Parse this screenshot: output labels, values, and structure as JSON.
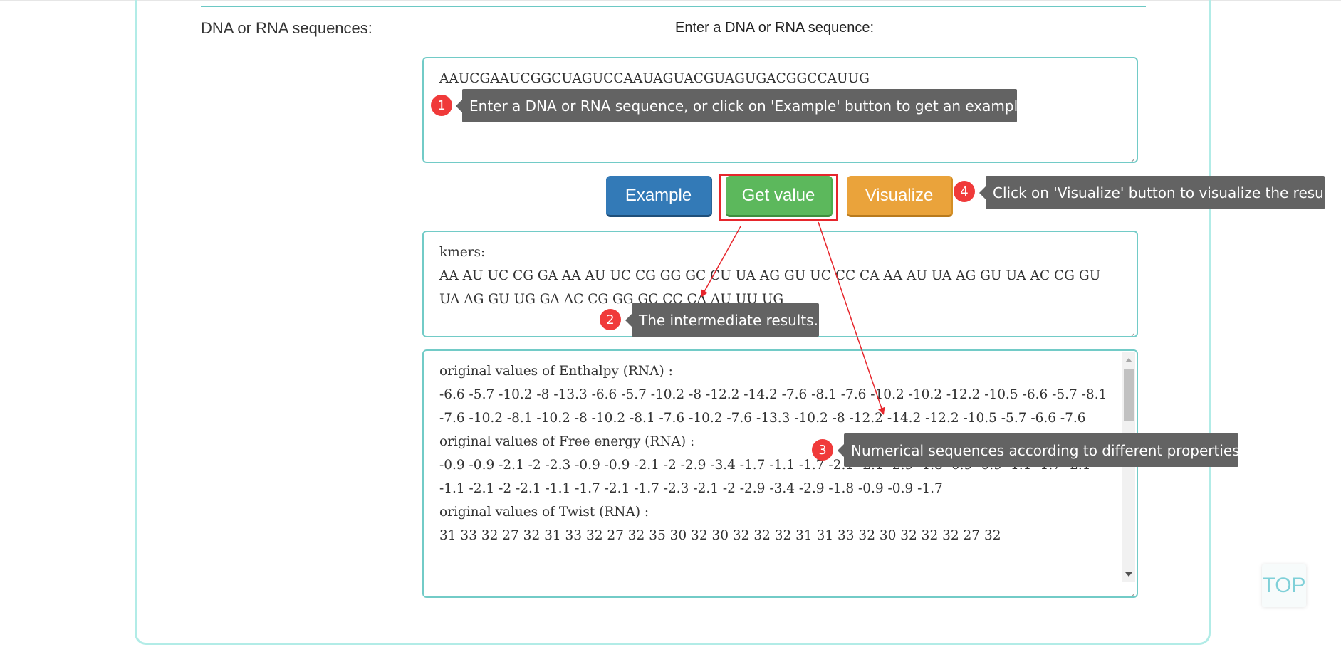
{
  "section": {
    "label": "DNA or RNA sequences:",
    "input_heading": "Enter a DNA or RNA sequence:"
  },
  "sequence_input": {
    "value": "AAUCGAAUCGGCUAGUCCAAUAGUACGUAGUGACGGCCAUUG"
  },
  "buttons": {
    "example": "Example",
    "get_value": "Get value",
    "visualize": "Visualize"
  },
  "kmers_output": {
    "value": "kmers:\nAA AU UC CG GA AA AU UC CG GG GC CU UA AG GU UC CC CA AA AU UA AG GU UA AC CG GU UA AG GU UG GA AC CG GG GC CC CA AU UU UG"
  },
  "values_output": {
    "value": "original values of Enthalpy (RNA) :\n-6.6 -5.7 -10.2 -8 -13.3 -6.6 -5.7 -10.2 -8 -12.2 -14.2 -7.6 -8.1 -7.6 -10.2 -10.2 -12.2 -10.5 -6.6 -5.7 -8.1 -7.6 -10.2 -8.1 -10.2 -8 -10.2 -8.1 -7.6 -10.2 -7.6 -13.3 -10.2 -8 -12.2 -14.2 -12.2 -10.5 -5.7 -6.6 -7.6\noriginal values of Free energy (RNA) :\n-0.9 -0.9 -2.1 -2 -2.3 -0.9 -0.9 -2.1 -2 -2.9 -3.4 -1.7 -1.1 -1.7 -2.1 -2.1 -2.9 -1.8 -0.9 -0.9 -1.1 -1.7 -2.1 -1.1 -2.1 -2 -2.1 -1.1 -1.7 -2.1 -1.7 -2.3 -2.1 -2 -2.9 -3.4 -2.9 -1.8 -0.9 -0.9 -1.7\noriginal values of Twist (RNA) :\n31 33 32 27 32 31 33 32 27 32 35 30 32 30 32 32 32 31 31 33 32 30 32 32 32 27 32"
  },
  "tips": [
    {
      "number": "1",
      "text": "Enter a DNA or RNA sequence, or click on 'Example' button to get an example."
    },
    {
      "number": "2",
      "text": "The intermediate results."
    },
    {
      "number": "3",
      "text": "Numerical sequences according to different properties."
    },
    {
      "number": "4",
      "text": "Click on 'Visualize' button to visualize the results"
    }
  ],
  "top_button": "TOP",
  "colors": {
    "frame": "#b2ece7",
    "textbox_border": "#72cbc7",
    "example": "#337ab7",
    "get_value": "#5cb85c",
    "visualize": "#eaa33b",
    "tip_bg": "#636363",
    "badge": "#f03a3a",
    "highlight": "#e6262c"
  }
}
